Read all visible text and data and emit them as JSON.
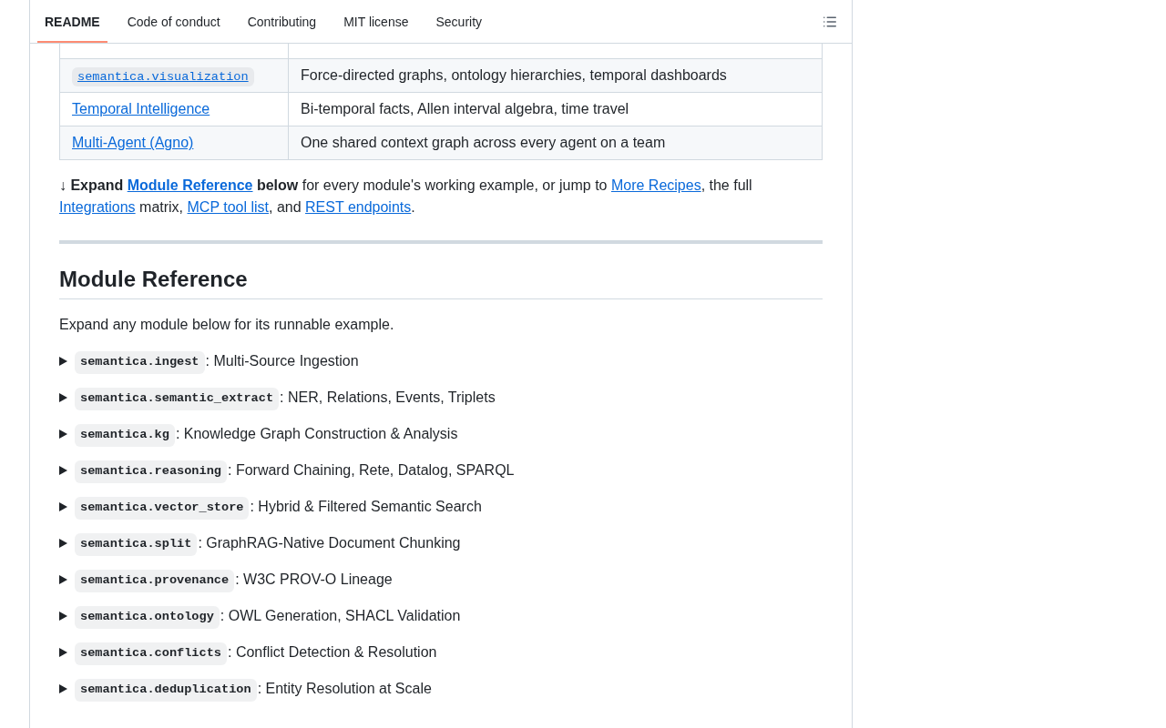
{
  "tabs": [
    {
      "label": "README",
      "selected": true
    },
    {
      "label": "Code of conduct",
      "selected": false
    },
    {
      "label": "Contributing",
      "selected": false
    },
    {
      "label": "MIT license",
      "selected": false
    },
    {
      "label": "Security",
      "selected": false
    }
  ],
  "table": {
    "rows": [
      {
        "cells": [
          {
            "kind": "code_link",
            "text": "semantica.visualization"
          },
          {
            "kind": "text",
            "text": "Force-directed graphs, ontology hierarchies, temporal dashboards"
          }
        ]
      },
      {
        "cells": [
          {
            "kind": "link",
            "text": "Temporal Intelligence"
          },
          {
            "kind": "text",
            "text": "Bi-temporal facts, Allen interval algebra, time travel"
          }
        ]
      },
      {
        "cells": [
          {
            "kind": "link",
            "text": "Multi-Agent (Agno)"
          },
          {
            "kind": "text",
            "text": "One shared context graph across every agent on a team"
          }
        ]
      }
    ]
  },
  "note": [
    {
      "kind": "bold",
      "text": "↓ Expand "
    },
    {
      "kind": "bold_link",
      "text": "Module Reference"
    },
    {
      "kind": "bold",
      "text": " below"
    },
    {
      "kind": "text",
      "text": " for every module's working example, or jump to "
    },
    {
      "kind": "link",
      "text": "More Recipes"
    },
    {
      "kind": "text",
      "text": ", the full "
    },
    {
      "kind": "link",
      "text": "Integrations"
    },
    {
      "kind": "text",
      "text": " matrix, "
    },
    {
      "kind": "link",
      "text": "MCP tool list"
    },
    {
      "kind": "text",
      "text": ", and "
    },
    {
      "kind": "link",
      "text": "REST endpoints"
    },
    {
      "kind": "text",
      "text": "."
    }
  ],
  "heading": "Module Reference",
  "intro": "Expand any module below for its runnable example.",
  "modules": [
    {
      "code": "semantica.ingest",
      "title": ": Multi-Source Ingestion",
      "expanded": false
    },
    {
      "code": "semantica.semantic_extract",
      "title": ": NER, Relations, Events, Triplets",
      "expanded": false
    },
    {
      "code": "semantica.kg",
      "title": ": Knowledge Graph Construction & Analysis",
      "expanded": false
    },
    {
      "code": "semantica.reasoning",
      "title": ": Forward Chaining, Rete, Datalog, SPARQL",
      "expanded": false
    },
    {
      "code": "semantica.vector_store",
      "title": ": Hybrid & Filtered Semantic Search",
      "expanded": false
    },
    {
      "code": "semantica.split",
      "title": ": GraphRAG-Native Document Chunking",
      "expanded": false
    },
    {
      "code": "semantica.provenance",
      "title": ": W3C PROV-O Lineage",
      "expanded": false
    },
    {
      "code": "semantica.ontology",
      "title": ": OWL Generation, SHACL Validation",
      "expanded": false
    },
    {
      "code": "semantica.conflicts",
      "title": ": Conflict Detection & Resolution",
      "expanded": false
    },
    {
      "code": "semantica.deduplication",
      "title": ": Entity Resolution at Scale",
      "expanded": false
    }
  ]
}
